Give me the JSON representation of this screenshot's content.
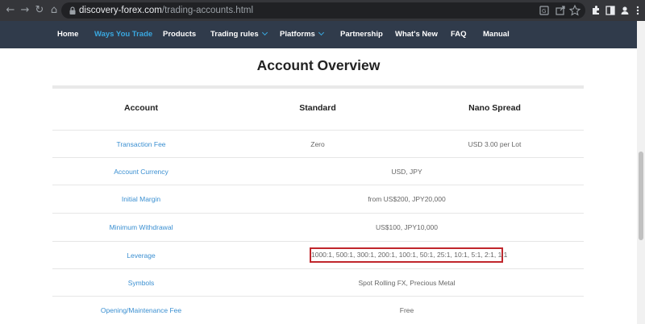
{
  "browser": {
    "url_host": "discovery-forex.com",
    "url_path": "/trading-accounts.html"
  },
  "nav": {
    "items": [
      {
        "label": "Home"
      },
      {
        "label": "Ways You Trade"
      },
      {
        "label": "Products"
      },
      {
        "label": "Trading rules"
      },
      {
        "label": "Platforms"
      },
      {
        "label": "Partnership"
      },
      {
        "label": "What's New"
      },
      {
        "label": "FAQ"
      },
      {
        "label": "Manual"
      }
    ],
    "active_color": "#3aa8e0",
    "background": "#303b4b"
  },
  "page": {
    "title": "Account Overview"
  },
  "table": {
    "headers": [
      "Account",
      "Standard",
      "Nano Spread"
    ],
    "rows": [
      {
        "label": "Transaction Fee",
        "standard": "Zero",
        "nano": "USD 3.00 per Lot"
      },
      {
        "label": "Account Currency",
        "shared": "USD, JPY"
      },
      {
        "label": "Initial Margin",
        "shared": "from US$200, JPY20,000"
      },
      {
        "label": "Minimum Withdrawal",
        "shared": "US$100, JPY10,000"
      },
      {
        "label": "Leverage",
        "shared": "1000:1, 500:1, 300:1, 200:1, 100:1, 50:1, 25:1, 10:1, 5:1, 2:1, 1:1"
      },
      {
        "label": "Symbols",
        "shared": "Spot Rolling FX, Precious Metal"
      },
      {
        "label": "Opening/Maintenance Fee",
        "shared": "Free"
      }
    ]
  },
  "colors": {
    "label_link": "#3a8fd1",
    "highlight": "#c0262c"
  }
}
